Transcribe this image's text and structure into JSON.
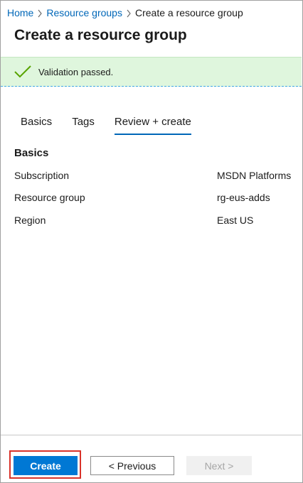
{
  "breadcrumb": {
    "items": [
      {
        "label": "Home"
      },
      {
        "label": "Resource groups"
      },
      {
        "label": "Create a resource group"
      }
    ]
  },
  "page": {
    "title": "Create a resource group"
  },
  "validation": {
    "message": "Validation passed.",
    "status_color": "#57a300"
  },
  "tabs": [
    {
      "label": "Basics",
      "active": false
    },
    {
      "label": "Tags",
      "active": false
    },
    {
      "label": "Review + create",
      "active": true
    }
  ],
  "summary": {
    "heading": "Basics",
    "rows": [
      {
        "label": "Subscription",
        "value": "MSDN Platforms"
      },
      {
        "label": "Resource group",
        "value": "rg-eus-adds"
      },
      {
        "label": "Region",
        "value": "East US"
      }
    ]
  },
  "footer": {
    "create_label": "Create",
    "previous_label": "< Previous",
    "next_label": "Next >",
    "accent_color": "#0078d4"
  }
}
